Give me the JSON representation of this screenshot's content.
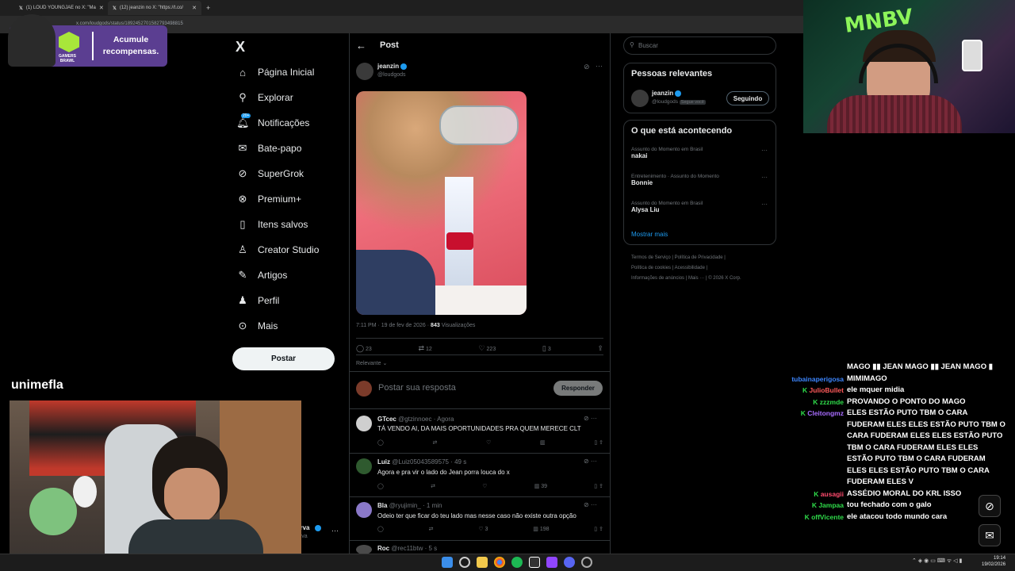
{
  "browser": {
    "tabs": [
      {
        "label": "(1) LOUD YOUNGJAE no X: \"Ma"
      },
      {
        "label": "(12) jeanzin no X: \"https://t.co/"
      }
    ],
    "url": "x.com/loudgods/status/1892452701582793498815"
  },
  "nav": {
    "logo": "X",
    "items": [
      {
        "label": "Página Inicial",
        "icon": "home-icon"
      },
      {
        "label": "Explorar",
        "icon": "search-icon"
      },
      {
        "label": "Notificações",
        "icon": "bell-icon",
        "badge": "20+"
      },
      {
        "label": "Bate-papo",
        "icon": "mail-icon"
      },
      {
        "label": "SuperGrok",
        "icon": "grok-icon"
      },
      {
        "label": "Premium+",
        "icon": "x-circle-icon"
      },
      {
        "label": "Itens salvos",
        "icon": "bookmark-icon"
      },
      {
        "label": "Creator Studio",
        "icon": "creator-icon"
      },
      {
        "label": "Artigos",
        "icon": "article-icon"
      },
      {
        "label": "Perfil",
        "icon": "person-icon"
      },
      {
        "label": "Mais",
        "icon": "more-circle-icon"
      }
    ],
    "post_button": "Postar",
    "account_name": "erva",
    "account_handle": "erva"
  },
  "post": {
    "header_title": "Post",
    "author": "jeanzin",
    "handle": "@loudgods",
    "time": "7:11 PM · 19 de fev de 2026 ·",
    "views": "843",
    "views_label": "Visualizações",
    "stats": {
      "replies": "23",
      "reposts": "12",
      "likes": "223",
      "bookmarks": "3"
    },
    "sort_label": "Relevante",
    "reply_placeholder": "Postar sua resposta",
    "reply_button": "Responder"
  },
  "comments": [
    {
      "name": "GTcec",
      "handle": "@gtzinnoec · Agora",
      "text": "TÁ VENDO AI, DA MAIS OPORTUNIDADES PRA QUEM MERECE CLT",
      "views": "",
      "likes": ""
    },
    {
      "name": "Luiz",
      "handle": "@Luiz05043589575 · 49 s",
      "text": "Agora e pra vir o lado do Jean porra louca do x",
      "views": "39",
      "likes": ""
    },
    {
      "name": "Bla",
      "handle": "@ryujimin_ · 1 min",
      "text": "Odeio ter que ficar do teu lado mas nesse caso não existe outra opção",
      "views": "198",
      "likes": "3"
    },
    {
      "name": "Roc",
      "handle": "@rec11btw · 5 s",
      "text": "",
      "views": "",
      "likes": ""
    }
  ],
  "right": {
    "search_placeholder": "Buscar",
    "people_title": "Pessoas relevantes",
    "person_name": "jeanzin",
    "person_handle": "@loudgods",
    "person_follows_you": "Segue você",
    "follow_button": "Seguindo",
    "trends_title": "O que está acontecendo",
    "trends": [
      {
        "context": "Assunto do Momento em Brasil",
        "name": "nakai"
      },
      {
        "context": "Entretenimento · Assunto do Momento",
        "name": "Bonnie"
      },
      {
        "context": "Assunto do Momento em Brasil",
        "name": "Alysa Liu"
      }
    ],
    "show_more": "Mostrar mais",
    "footer": [
      "Termos de Serviço",
      "Política de Privacidade",
      "Política de cookies",
      "Acessibilidade",
      "Informações de anúncios",
      "Mais ···",
      "© 2026 X Corp."
    ]
  },
  "overlay": {
    "reward_text_1": "Acumule",
    "reward_text_2": "recompensas.",
    "gamers_1": "GAMERS",
    "gamers_2": "BRAWL",
    "streamer_name": "unimefla",
    "cam_logo": "MNBV"
  },
  "chat": [
    {
      "user": "",
      "text": "MAGO ▮▮ JEAN MAGO ▮▮ JEAN MAGO ▮",
      "color": "#ffffff"
    },
    {
      "user": "tubainaperigosa",
      "text": "MIMIMAGO",
      "color": "#3d86ff"
    },
    {
      "user": "JulioBullet",
      "text": "ele mquer midia",
      "color": "#ff5a5a"
    },
    {
      "user": "zzzmde",
      "text": "PROVANDO O PONTO DO MAGO",
      "color": "#2fdc4a"
    },
    {
      "user": "Cleitongmz",
      "text": "ELES ESTÃO PUTO TBM O CARA FUDERAM ELES ELES ESTÃO PUTO TBM O CARA FUDERAM ELES ELES ESTÃO PUTO TBM O CARA FUDERAM ELES ELES ESTÃO PUTO TBM O CARA FUDERAM ELES ELES ESTÃO PUTO TBM O CARA FUDERAM ELES V",
      "color": "#a86cff"
    },
    {
      "user": "ausagii",
      "text": "ASSÉDIO MORAL DO KRL ISSO",
      "color": "#ff4b6e"
    },
    {
      "user": "Jampaa",
      "text": "tou fechado com o galo",
      "color": "#2fdc4a"
    },
    {
      "user": "offVicente",
      "text": "ele atacou todo mundo cara",
      "color": "#2fdc4a"
    }
  ],
  "taskbar": {
    "time": "19:14",
    "date": "19/02/2026"
  }
}
